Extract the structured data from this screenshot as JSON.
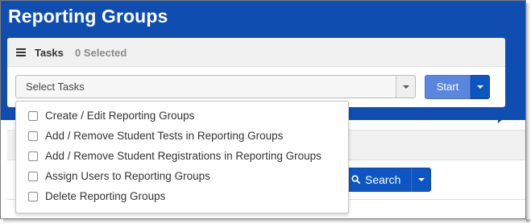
{
  "page": {
    "title": "Reporting Groups"
  },
  "tasks_panel": {
    "label": "Tasks",
    "selected_count": "0 Selected",
    "select_placeholder": "Select Tasks",
    "start_label": "Start"
  },
  "task_options": [
    {
      "label": "Create / Edit Reporting Groups",
      "checked": false
    },
    {
      "label": "Add / Remove Student Tests in Reporting Groups",
      "checked": false
    },
    {
      "label": "Add / Remove Student Registrations in Reporting Groups",
      "checked": false
    },
    {
      "label": "Assign Users to Reporting Groups",
      "checked": false
    },
    {
      "label": "Delete Reporting Groups",
      "checked": false
    }
  ],
  "search": {
    "label": "Search"
  },
  "icons": {
    "tasks": "list-icon",
    "select_caret": "chevron-down-icon",
    "search": "search-icon"
  },
  "colors": {
    "header": "#0f4eb0",
    "primary_button": "#0d55c2",
    "start_button": "#5b86e0"
  }
}
